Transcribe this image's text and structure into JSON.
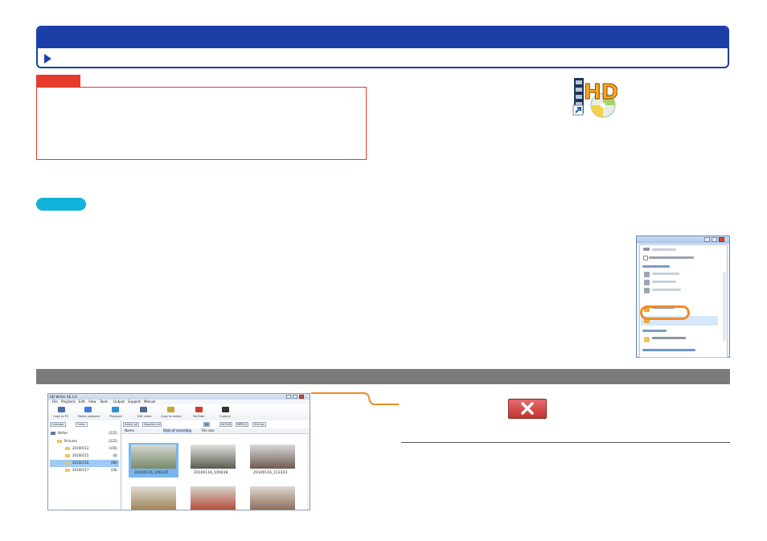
{
  "colors": {
    "header_blue": "#1b3fa6",
    "notice_red": "#e63a2c",
    "tip_cyan": "#11b4d8",
    "section_grey": "#7b7b7b",
    "callout_orange": "#f08a25"
  },
  "icons": {
    "header_arrow": "triangle-right-icon",
    "app_icon": "hd-writer-ae-icon",
    "close_button": "close-x-icon"
  },
  "hdwriter": {
    "title": "HD Writer AE 2.6",
    "menu": [
      "File",
      "Playback",
      "Edit",
      "View",
      "Tools",
      "Output",
      "Support",
      "Manual"
    ],
    "toolbar": [
      "Copy to PC",
      "Media playback",
      "Playback",
      "Edit video",
      "Copy to media",
      "YouTube",
      "Capture"
    ],
    "tabs": [
      "Calendar",
      "Folder"
    ],
    "tree": [
      {
        "label": "Writer",
        "count": "(222)"
      },
      {
        "label": "Pictures",
        "count": "(222)"
      },
      {
        "label": "20100112",
        "count": "(100)"
      },
      {
        "label": "20100115",
        "count": "(8)"
      },
      {
        "label": "20100116",
        "count": "(96)"
      },
      {
        "label": "20100117",
        "count": "(18)"
      }
    ],
    "actions": [
      "Select all",
      "Deselect all"
    ],
    "filters": [
      "All",
      "AVCHD",
      "MPEG2",
      "Still pic"
    ],
    "columns": [
      "Name",
      "Date of recording",
      "File size"
    ],
    "thumbs": [
      "20100116_100320",
      "20100116_100438",
      "20100116_112223"
    ]
  }
}
